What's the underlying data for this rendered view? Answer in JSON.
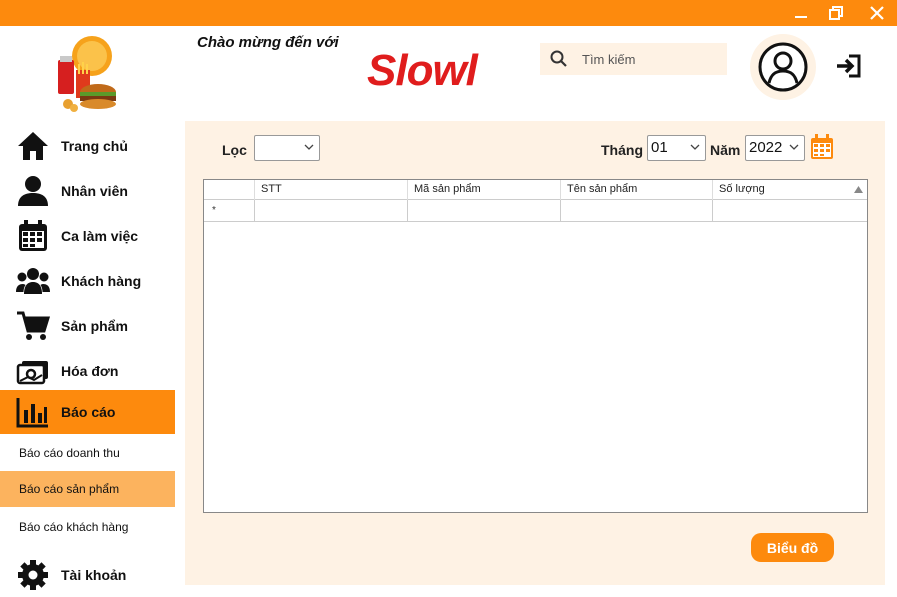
{
  "window": {
    "minimize_icon": "minimize-icon",
    "restore_icon": "restore-icon",
    "close_icon": "close-icon"
  },
  "colors": {
    "accent": "#fd8a0d",
    "accent_light": "#fcb35e",
    "panel": "#fef2e4",
    "brand_red": "#e01d1d"
  },
  "sidebar": {
    "items": [
      {
        "label": "Trang chủ",
        "icon": "home-icon"
      },
      {
        "label": "Nhân viên",
        "icon": "user-icon"
      },
      {
        "label": "Ca làm việc",
        "icon": "calendar-icon"
      },
      {
        "label": "Khách hàng",
        "icon": "group-icon"
      },
      {
        "label": "Sản phẩm",
        "icon": "cart-icon"
      },
      {
        "label": "Hóa đơn",
        "icon": "money-icon"
      },
      {
        "label": "Báo cáo",
        "icon": "bar-chart-icon"
      }
    ],
    "sub_items": [
      {
        "label": "Báo cáo doanh thu"
      },
      {
        "label": "Báo cáo sản phẩm"
      },
      {
        "label": "Báo cáo khách hàng"
      }
    ],
    "account": {
      "label": "Tài khoản",
      "icon": "gear-icon"
    }
  },
  "header": {
    "welcome": "Chào mừng đến với",
    "brand": "Slowl",
    "search_placeholder": "Tìm kiếm"
  },
  "filters": {
    "filter_label": "Lọc",
    "filter_value": "",
    "month_label": "Tháng",
    "month_value": "01",
    "year_label": "Năm",
    "year_value": "2022"
  },
  "table": {
    "columns": [
      "STT",
      "Mã sản phẩm",
      "Tên sản phẩm",
      "Số lượng"
    ],
    "new_row_marker": "*"
  },
  "buttons": {
    "chart": "Biểu đồ"
  }
}
